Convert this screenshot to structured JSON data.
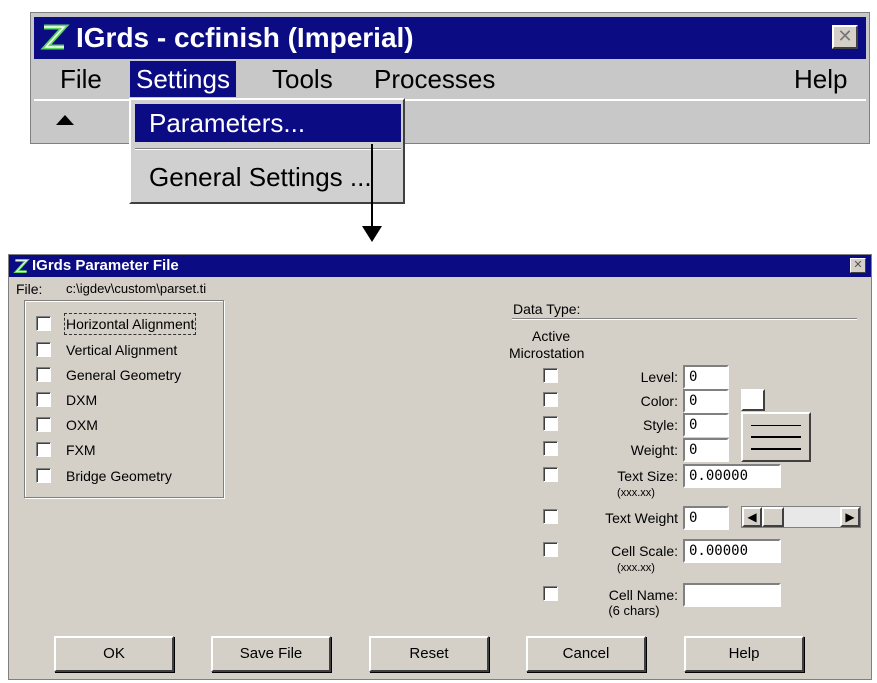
{
  "main_window": {
    "title": "IGrds - ccfinish (Imperial)",
    "close_glyph": "✕",
    "menu": [
      "File",
      "Settings",
      "Tools",
      "Processes",
      "Help"
    ],
    "settings_menu": [
      "Parameters...",
      "General Settings ..."
    ]
  },
  "dialog": {
    "title": "IGrds Parameter File",
    "close_glyph": "✕",
    "file_label": "File:",
    "file_path": "c:\\igdev\\custom\\parset.ti",
    "checklist": [
      {
        "label": "Horizontal Alignment",
        "checked": false
      },
      {
        "label": "Vertical Alignment",
        "checked": false
      },
      {
        "label": "General Geometry",
        "checked": false
      },
      {
        "label": "DXM",
        "checked": false
      },
      {
        "label": "OXM",
        "checked": false
      },
      {
        "label": "FXM",
        "checked": false
      },
      {
        "label": "Bridge Geometry",
        "checked": false
      }
    ],
    "data_type_label": "Data Type:",
    "active_label": "Active",
    "microstation_label": "Microstation",
    "params": {
      "level": {
        "label": "Level:",
        "value": "0"
      },
      "color": {
        "label": "Color:",
        "value": "0"
      },
      "style": {
        "label": "Style:",
        "value": "0"
      },
      "weight": {
        "label": "Weight:",
        "value": "0"
      },
      "text_size": {
        "label": "Text Size:",
        "value": "0.00000",
        "hint": "(xxx.xx)"
      },
      "text_weight": {
        "label": "Text Weight",
        "value": "0"
      },
      "cell_scale": {
        "label": "Cell Scale:",
        "value": "0.00000",
        "hint": "(xxx.xx)"
      },
      "cell_name": {
        "label": "Cell Name:",
        "value": "",
        "hint": "(6 chars)"
      }
    },
    "scroll_left": "◀",
    "scroll_right": "▶",
    "buttons": {
      "ok": "OK",
      "save": "Save File",
      "reset": "Reset",
      "cancel": "Cancel",
      "help": "Help"
    }
  },
  "colors": {
    "titlebar": "#0b0b84",
    "face": "#d4d0c8"
  }
}
